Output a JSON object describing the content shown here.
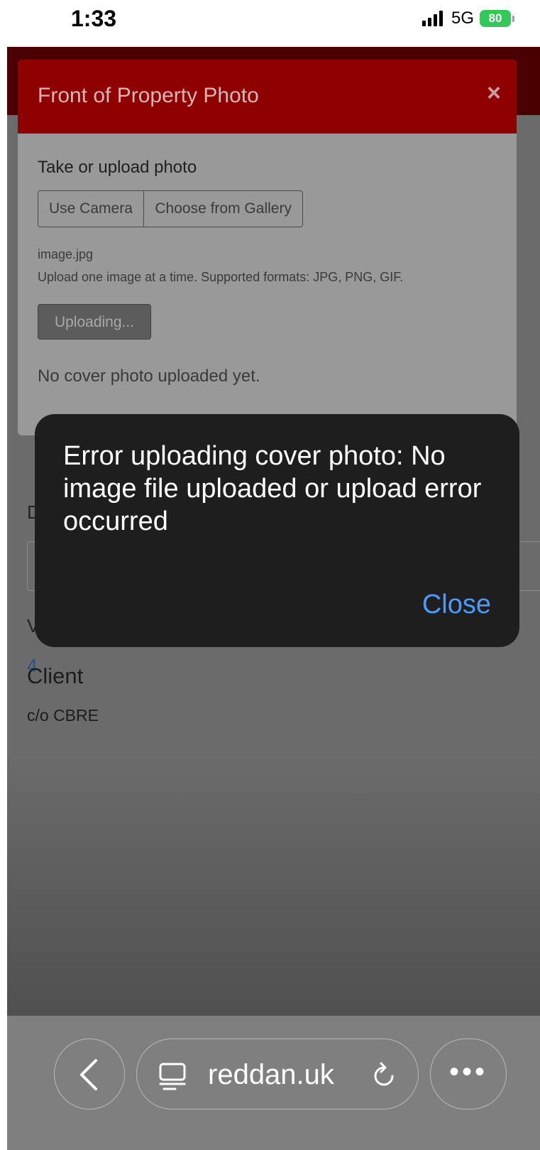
{
  "status_bar": {
    "time": "1:33",
    "network": "5G",
    "battery": "80"
  },
  "page": {
    "label_d": "D",
    "label_v": "V",
    "link_fragment": "4",
    "client_heading": "Client",
    "client_value": "c/o CBRE"
  },
  "modal": {
    "title": "Front of Property Photo",
    "close_symbol": "×",
    "take_label": "Take or upload photo",
    "use_camera": "Use Camera",
    "choose_gallery": "Choose from Gallery",
    "file_name": "image.jpg",
    "hint": "Upload one image at a time. Supported formats: JPG, PNG, GIF.",
    "uploading": "Uploading...",
    "no_cover": "No cover photo uploaded yet."
  },
  "alert": {
    "message": "Error uploading cover photo: No image file uploaded or upload error occurred",
    "close_label": "Close"
  },
  "browser": {
    "url": "reddan.uk"
  },
  "colors": {
    "header_red": "#8f0000",
    "alert_bg": "#1e1e1e",
    "alert_link": "#4a9bff",
    "battery_green": "#34c759"
  }
}
